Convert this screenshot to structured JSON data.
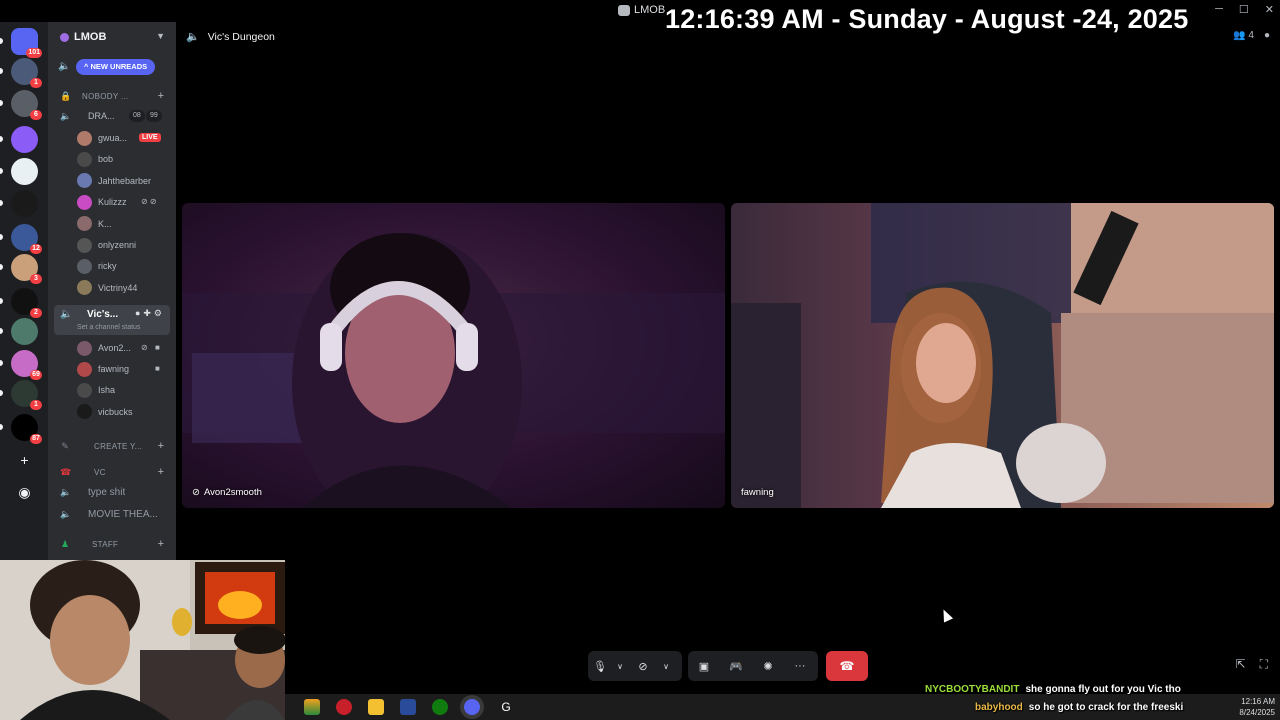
{
  "titlebar": {
    "app_name": "LMOB"
  },
  "overlay": {
    "clock_text": "12:16:39 AM - Sunday - August -24, 2025"
  },
  "guilds": {
    "items": [
      {
        "name": "direct-messages",
        "badge": "101",
        "color": "#5865f2"
      },
      {
        "name": "server-1",
        "badge": "1",
        "color": "#4a5a78"
      },
      {
        "name": "server-r",
        "badge": "6",
        "color": "#5a5e66"
      },
      {
        "name": "server-3",
        "badge": "",
        "color": "#8b5cf6"
      },
      {
        "name": "server-4",
        "badge": "",
        "color": "#e8f0f4"
      },
      {
        "name": "server-5",
        "badge": "",
        "color": "#1a1a1a"
      },
      {
        "name": "server-6",
        "badge": "12",
        "color": "#3b5998"
      },
      {
        "name": "server-7",
        "badge": "3",
        "color": "#c9a07a"
      },
      {
        "name": "server-stream",
        "badge": "2",
        "color": "#111111"
      },
      {
        "name": "server-9",
        "badge": "",
        "color": "#4d7a6a"
      },
      {
        "name": "server-10",
        "badge": "69",
        "color": "#c76cc6"
      },
      {
        "name": "server-11",
        "badge": "1",
        "color": "#2c3a33"
      },
      {
        "name": "server-nss",
        "badge": "87",
        "color": "#000000"
      }
    ]
  },
  "sidebar": {
    "server_name": "LMOB",
    "new_unreads": "NEW UNREADS",
    "categories": {
      "nobody": "NOBODY ...",
      "create": "CREATE Y...",
      "vc": "VC",
      "staff": "STAFF"
    },
    "channels": {
      "dra": "DRA...",
      "dra_counts": [
        "08",
        "99"
      ],
      "vics": "Vic's...",
      "vics_status": "Set a channel status",
      "type_shit": "type shit",
      "movie": "MOVIE THEA..."
    },
    "users_top": [
      {
        "name": "gwua...",
        "color": "#b07a6a"
      },
      {
        "name": "bob",
        "color": "#4a4a4a"
      },
      {
        "name": "Jahthebarber",
        "color": "#6a7ab0"
      },
      {
        "name": "Kulizzz",
        "color": "#c94cc5"
      },
      {
        "name": "K...",
        "color": "#8a6a6a"
      },
      {
        "name": "onlyzenni",
        "color": "#555555"
      },
      {
        "name": "ricky",
        "color": "#5a5e66"
      },
      {
        "name": "Victriny44",
        "color": "#8a7a5a"
      }
    ],
    "live_badge": "LIVE",
    "users_vics": [
      {
        "name": "Avon2...",
        "color": "#7a5a6a"
      },
      {
        "name": "fawning",
        "color": "#b04a4a"
      },
      {
        "name": "Isha",
        "color": "#4a4a4a"
      },
      {
        "name": "vicbucks",
        "color": "#1a1a1a"
      }
    ]
  },
  "voice": {
    "channel_name": "Vic's Dungeon",
    "participant_count": "4",
    "tiles": [
      {
        "name": "Avon2smooth"
      },
      {
        "name": "fawning"
      }
    ]
  },
  "chat": {
    "messages": [
      {
        "user": "NYCBOOTYBANDIT",
        "text": "she gonna fly out for you Vic tho"
      },
      {
        "user": "babyhood",
        "text": "so he got to crack for the freeski"
      }
    ]
  },
  "taskbar": {
    "time": "12:16 AM",
    "date": "8/24/2025"
  }
}
